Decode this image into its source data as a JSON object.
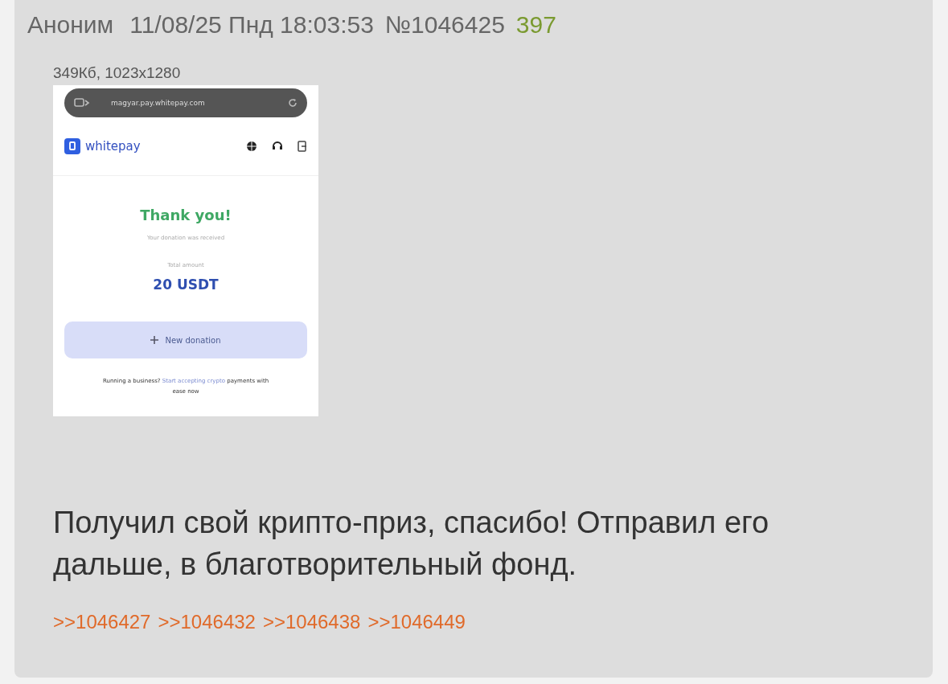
{
  "post": {
    "author": "Аноним",
    "date": "11/08/25 Пнд 18:03:53",
    "number": "№1046425",
    "ordinal": "397",
    "file": {
      "info": "349Кб, 1023x1280",
      "screenshot": {
        "url": "magyar.pay.whitepay.com",
        "brand": "whitepay",
        "heading": "Thank you!",
        "subtitle": "Your donation was received",
        "amount_label": "Total amount",
        "amount": "20 USDT",
        "button": "New donation",
        "footer": "Running a business?",
        "footer_link": "Start accepting crypto",
        "footer_rest": "payments with ease now"
      }
    },
    "message": "Получил свой крипто-приз, спасибо! Отправил его дальше, в благотворительный фонд.",
    "replies": [
      ">>1046427",
      ">>1046432",
      ">>1046438",
      ">>1046449"
    ]
  }
}
